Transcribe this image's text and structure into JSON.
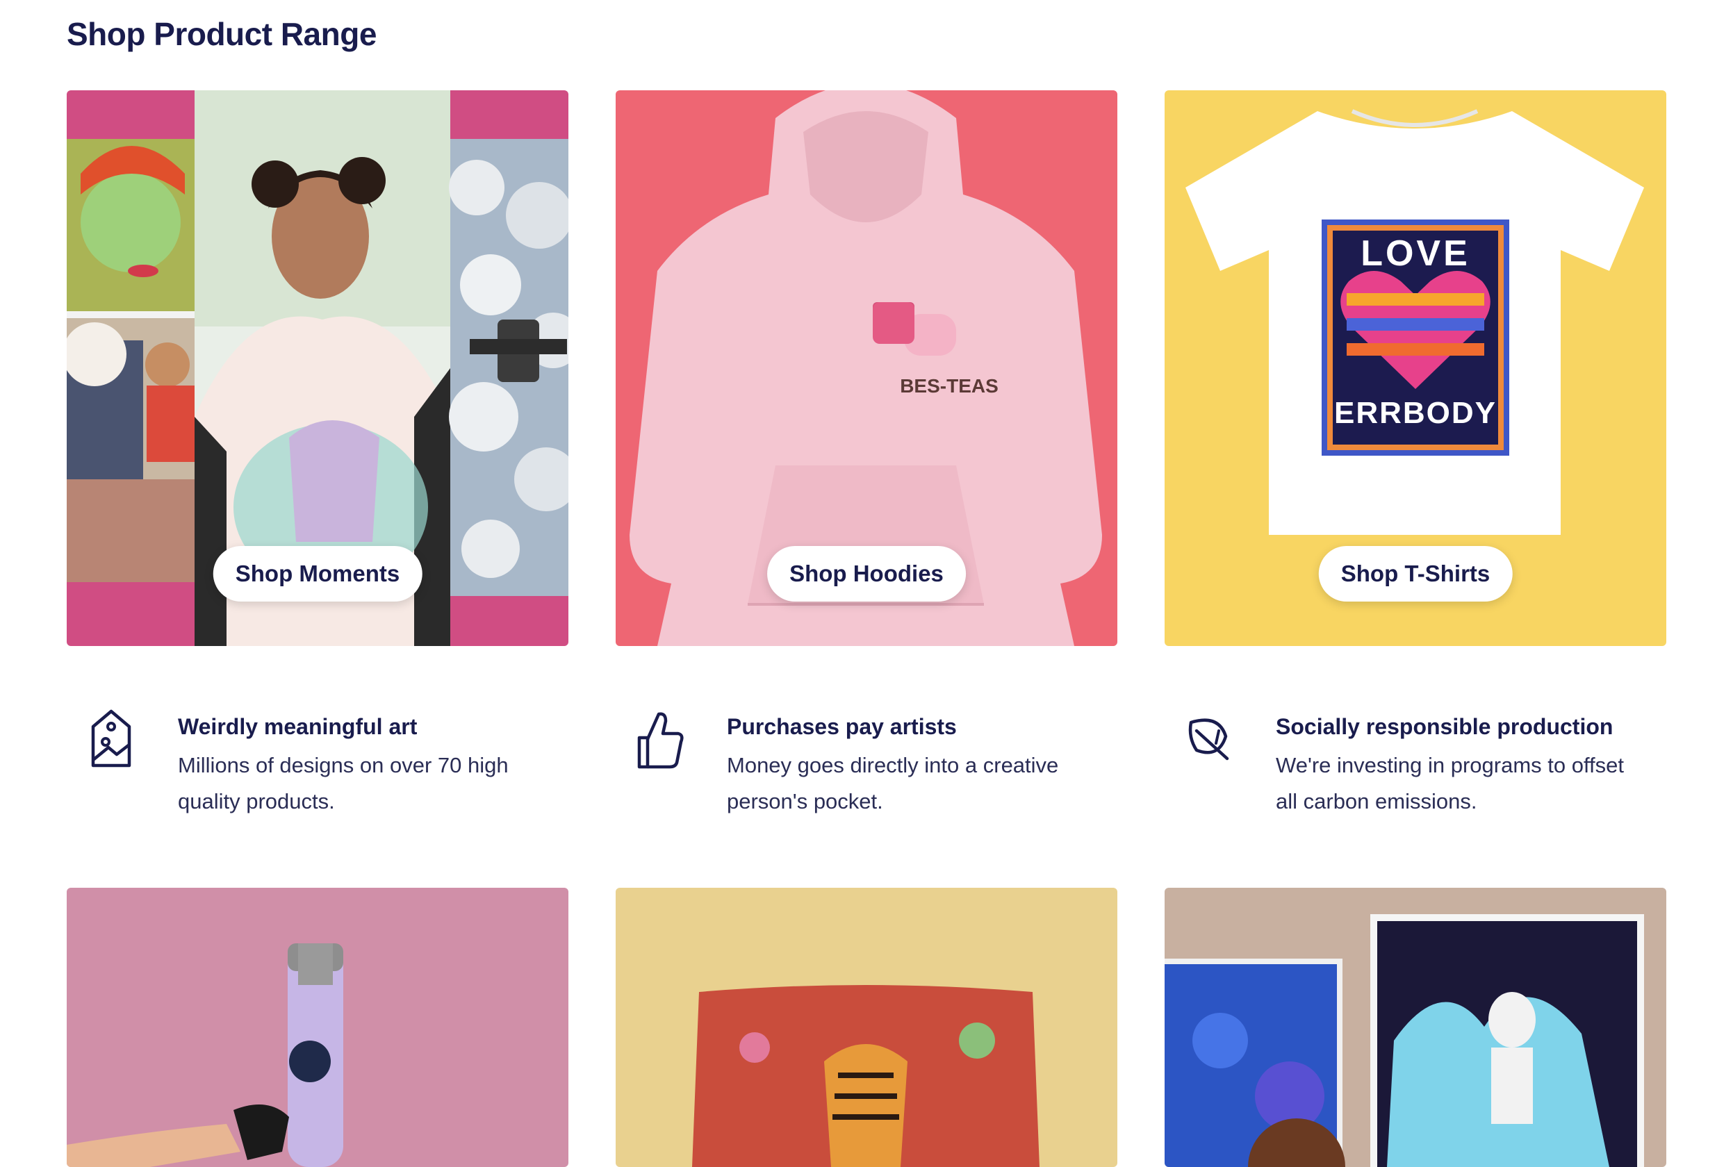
{
  "page": {
    "title": "Shop Product Range"
  },
  "tiles": [
    {
      "label": "Shop Moments",
      "bg": "#d04d83"
    },
    {
      "label": "Shop Hoodies",
      "bg": "#ee6673",
      "artwork_text": "BES-TEAS"
    },
    {
      "label": "Shop T-Shirts",
      "bg": "#f8d562",
      "artwork_text_top": "LOVE",
      "artwork_text_bottom": "ERRBODY"
    },
    {
      "label": "",
      "bg": "#d08fa8"
    },
    {
      "label": "",
      "bg": "#e9d18f"
    },
    {
      "label": "",
      "bg": "#c8b0a0"
    }
  ],
  "features": [
    {
      "icon": "image-tag-icon",
      "title": "Weirdly meaningful art",
      "description": "Millions of designs on over 70 high quality products."
    },
    {
      "icon": "thumbs-up-icon",
      "title": "Purchases pay artists",
      "description": "Money goes directly into a creative person's pocket."
    },
    {
      "icon": "leaf-icon",
      "title": "Socially responsible production",
      "description": "We're investing in programs to offset all carbon emissions."
    }
  ],
  "colors": {
    "text": "#191c4d"
  }
}
